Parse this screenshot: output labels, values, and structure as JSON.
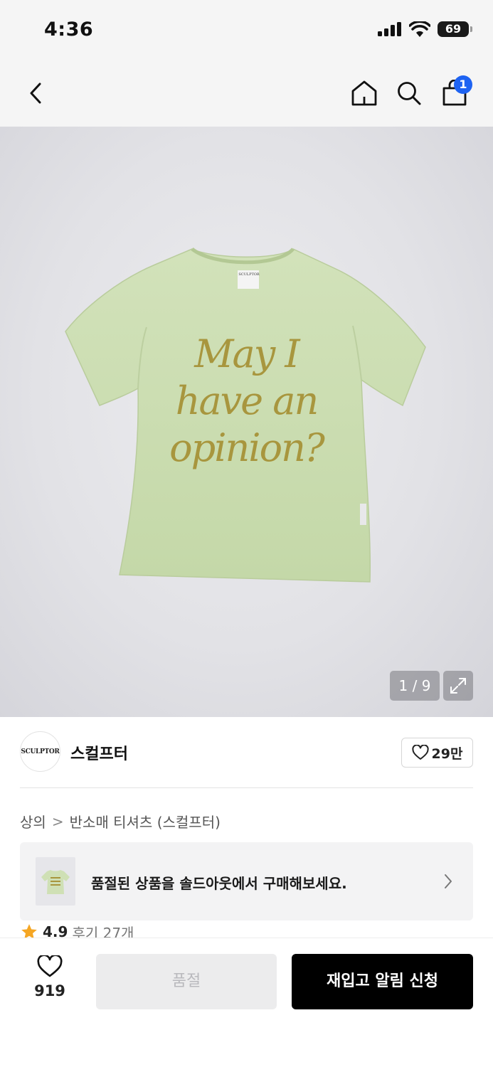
{
  "status_bar": {
    "time": "4:36",
    "battery": "69"
  },
  "nav": {
    "cart_count": "1"
  },
  "product_image": {
    "shirt_label": "SCULPTOR",
    "shirt_print": [
      "May I",
      "have an",
      "opinion?"
    ],
    "pager": "1 / 9"
  },
  "brand": {
    "logo_text": "SCULPTOR",
    "name": "스컬프터",
    "likes": "29만"
  },
  "breadcrumb": {
    "category": "상의",
    "separator": ">",
    "subcategory": "반소매 티셔츠 (스컬프터)"
  },
  "soldout_banner": {
    "text": "품절된 상품을 솔드아웃에서 구매해보세요."
  },
  "rating": {
    "score": "4.9",
    "reviews": "후기 27개"
  },
  "bottom_bar": {
    "wish_count": "919",
    "soldout_label": "품절",
    "restock_label": "재입고 알림 신청"
  },
  "colors": {
    "shirt": "#c9dbb0",
    "print": "#a8963e",
    "badge": "#1e63f2",
    "primary_button": "#000000"
  }
}
